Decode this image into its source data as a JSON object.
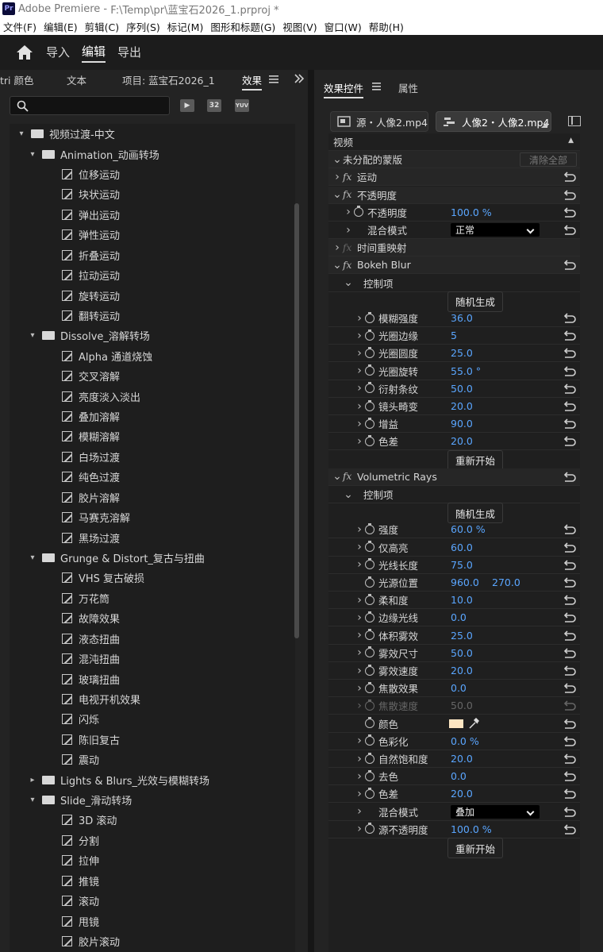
{
  "window": {
    "app": "Adobe Premiere",
    "path": "F:\\Temp\\pr\\蓝宝石2026_1.prproj *",
    "logo": "Pr"
  },
  "menu": [
    "文件(F)",
    "编辑(E)",
    "剪辑(C)",
    "序列(S)",
    "标记(M)",
    "图形和标题(G)",
    "视图(V)",
    "窗口(W)",
    "帮助(H)"
  ],
  "workspace": {
    "tabs": [
      "导入",
      "编辑",
      "导出"
    ],
    "active": "编辑"
  },
  "left_panel": {
    "tabs": [
      "tri 颜色",
      "文本",
      "项目: 蓝宝石2026_1",
      "效果"
    ],
    "active_tab": "效果",
    "search_placeholder": "",
    "filter_icons": [
      "32",
      "YUV"
    ],
    "tree": [
      {
        "label": "视频过渡-中文",
        "level": 0,
        "type": "folder",
        "expanded": true
      },
      {
        "label": "Animation_动画转场",
        "level": 1,
        "type": "folder",
        "expanded": true
      },
      {
        "label": "位移运动",
        "level": 2,
        "type": "preset"
      },
      {
        "label": "块状运动",
        "level": 2,
        "type": "preset"
      },
      {
        "label": "弹出运动",
        "level": 2,
        "type": "preset"
      },
      {
        "label": "弹性运动",
        "level": 2,
        "type": "preset"
      },
      {
        "label": "折叠运动",
        "level": 2,
        "type": "preset"
      },
      {
        "label": "拉动运动",
        "level": 2,
        "type": "preset"
      },
      {
        "label": "旋转运动",
        "level": 2,
        "type": "preset"
      },
      {
        "label": "翻转运动",
        "level": 2,
        "type": "preset"
      },
      {
        "label": "Dissolve_溶解转场",
        "level": 1,
        "type": "folder",
        "expanded": true
      },
      {
        "label": "Alpha 通道烧蚀",
        "level": 2,
        "type": "preset"
      },
      {
        "label": "交叉溶解",
        "level": 2,
        "type": "preset"
      },
      {
        "label": "亮度淡入淡出",
        "level": 2,
        "type": "preset"
      },
      {
        "label": "叠加溶解",
        "level": 2,
        "type": "preset"
      },
      {
        "label": "模糊溶解",
        "level": 2,
        "type": "preset"
      },
      {
        "label": "白场过渡",
        "level": 2,
        "type": "preset"
      },
      {
        "label": "纯色过渡",
        "level": 2,
        "type": "preset"
      },
      {
        "label": "胶片溶解",
        "level": 2,
        "type": "preset"
      },
      {
        "label": "马赛克溶解",
        "level": 2,
        "type": "preset"
      },
      {
        "label": "黑场过渡",
        "level": 2,
        "type": "preset"
      },
      {
        "label": "Grunge & Distort_复古与扭曲",
        "level": 1,
        "type": "folder",
        "expanded": true
      },
      {
        "label": "VHS 复古破损",
        "level": 2,
        "type": "preset"
      },
      {
        "label": "万花筒",
        "level": 2,
        "type": "preset"
      },
      {
        "label": "故障效果",
        "level": 2,
        "type": "preset"
      },
      {
        "label": "液态扭曲",
        "level": 2,
        "type": "preset"
      },
      {
        "label": "混沌扭曲",
        "level": 2,
        "type": "preset"
      },
      {
        "label": "玻璃扭曲",
        "level": 2,
        "type": "preset"
      },
      {
        "label": "电视开机效果",
        "level": 2,
        "type": "preset"
      },
      {
        "label": "闪烁",
        "level": 2,
        "type": "preset"
      },
      {
        "label": "陈旧复古",
        "level": 2,
        "type": "preset"
      },
      {
        "label": "震动",
        "level": 2,
        "type": "preset"
      },
      {
        "label": "Lights & Blurs_光效与模糊转场",
        "level": 1,
        "type": "folder",
        "expanded": false
      },
      {
        "label": "Slide_滑动转场",
        "level": 1,
        "type": "folder",
        "expanded": true
      },
      {
        "label": "3D 滚动",
        "level": 2,
        "type": "preset"
      },
      {
        "label": "分割",
        "level": 2,
        "type": "preset"
      },
      {
        "label": "拉伸",
        "level": 2,
        "type": "preset"
      },
      {
        "label": "推镜",
        "level": 2,
        "type": "preset"
      },
      {
        "label": "滚动",
        "level": 2,
        "type": "preset"
      },
      {
        "label": "甩镜",
        "level": 2,
        "type": "preset"
      },
      {
        "label": "胶片滚动",
        "level": 2,
        "type": "preset"
      }
    ]
  },
  "right_panel": {
    "tabs": [
      "效果控件",
      "属性"
    ],
    "active_tab": "效果控件",
    "source_label": "源・人像2.mp4",
    "sequence_label": "人像2・人像2.mp4",
    "rows": [
      {
        "kind": "section",
        "label": "视频"
      },
      {
        "kind": "mask",
        "label": "未分配的蒙版",
        "button": "清除全部"
      },
      {
        "kind": "effect",
        "label": "运动",
        "fx": true,
        "reset": true
      },
      {
        "kind": "effect",
        "label": "不透明度",
        "fx": true,
        "expanded": true,
        "reset": true
      },
      {
        "kind": "param",
        "indent": 1,
        "stopwatch": true,
        "label": "不透明度",
        "value": "100.0 %",
        "reset": true
      },
      {
        "kind": "dropdown",
        "indent": 1,
        "label": "混合模式",
        "value": "正常",
        "reset": true
      },
      {
        "kind": "effect",
        "label": "时间重映射",
        "fx": true,
        "fxdim": true
      },
      {
        "kind": "effect",
        "label": "Bokeh Blur",
        "fx": true,
        "expanded": true,
        "reset": true
      },
      {
        "kind": "group",
        "label": "控制项"
      },
      {
        "kind": "button",
        "label": "随机生成"
      },
      {
        "kind": "param",
        "indent": 2,
        "stopwatch": true,
        "label": "模糊强度",
        "value": "36.0",
        "reset": true
      },
      {
        "kind": "param",
        "indent": 2,
        "stopwatch": true,
        "label": "光圈边缘",
        "value": "5",
        "reset": true
      },
      {
        "kind": "param",
        "indent": 2,
        "stopwatch": true,
        "label": "光圈圆度",
        "value": "25.0",
        "reset": true
      },
      {
        "kind": "param",
        "indent": 2,
        "stopwatch": true,
        "label": "光圈旋转",
        "value": "55.0 °",
        "reset": true
      },
      {
        "kind": "param",
        "indent": 2,
        "stopwatch": true,
        "label": "衍射条纹",
        "value": "50.0",
        "reset": true
      },
      {
        "kind": "param",
        "indent": 2,
        "stopwatch": true,
        "label": "镜头畸变",
        "value": "20.0",
        "reset": true
      },
      {
        "kind": "param",
        "indent": 2,
        "stopwatch": true,
        "label": "增益",
        "value": "90.0",
        "reset": true
      },
      {
        "kind": "param",
        "indent": 2,
        "stopwatch": true,
        "label": "色差",
        "value": "20.0",
        "reset": true
      },
      {
        "kind": "button",
        "label": "重新开始"
      },
      {
        "kind": "effect",
        "label": "Volumetric Rays",
        "fx": true,
        "expanded": true,
        "reset": true
      },
      {
        "kind": "group",
        "label": "控制项"
      },
      {
        "kind": "button",
        "label": "随机生成"
      },
      {
        "kind": "param",
        "indent": 2,
        "stopwatch": true,
        "label": "强度",
        "value": "60.0 %",
        "reset": true
      },
      {
        "kind": "param",
        "indent": 2,
        "stopwatch": true,
        "label": "仅高亮",
        "value": "60.0",
        "reset": true
      },
      {
        "kind": "param",
        "indent": 2,
        "stopwatch": true,
        "label": "光线长度",
        "value": "75.0",
        "reset": true
      },
      {
        "kind": "param",
        "indent": 2,
        "stopwatch": true,
        "chev": false,
        "label": "光源位置",
        "value": "960.0",
        "value2": "270.0",
        "reset": true
      },
      {
        "kind": "param",
        "indent": 2,
        "stopwatch": true,
        "label": "柔和度",
        "value": "10.0",
        "reset": true
      },
      {
        "kind": "param",
        "indent": 2,
        "stopwatch": true,
        "label": "边缘光线",
        "value": "0.0",
        "reset": true
      },
      {
        "kind": "param",
        "indent": 2,
        "stopwatch": true,
        "label": "体积雾效",
        "value": "25.0",
        "reset": true
      },
      {
        "kind": "param",
        "indent": 2,
        "stopwatch": true,
        "label": "雾效尺寸",
        "value": "50.0",
        "reset": true
      },
      {
        "kind": "param",
        "indent": 2,
        "stopwatch": true,
        "label": "雾效速度",
        "value": "20.0",
        "reset": true
      },
      {
        "kind": "param",
        "indent": 2,
        "stopwatch": true,
        "label": "焦散效果",
        "value": "0.0",
        "reset": true
      },
      {
        "kind": "param",
        "indent": 2,
        "stopwatch": true,
        "label": "焦散速度",
        "value": "50.0",
        "reset": true,
        "disabled": true
      },
      {
        "kind": "color",
        "indent": 2,
        "stopwatch": true,
        "chev": false,
        "label": "颜色",
        "color": "#fde6c2",
        "reset": true
      },
      {
        "kind": "param",
        "indent": 2,
        "stopwatch": true,
        "label": "色彩化",
        "value": "0.0 %",
        "reset": true
      },
      {
        "kind": "param",
        "indent": 2,
        "stopwatch": true,
        "label": "自然饱和度",
        "value": "20.0",
        "reset": true
      },
      {
        "kind": "param",
        "indent": 2,
        "stopwatch": true,
        "label": "去色",
        "value": "0.0",
        "reset": true
      },
      {
        "kind": "param",
        "indent": 2,
        "stopwatch": true,
        "label": "色差",
        "value": "20.0",
        "reset": true
      },
      {
        "kind": "dropdown",
        "indent": 2,
        "label": "混合模式",
        "value": "叠加",
        "reset": true
      },
      {
        "kind": "param",
        "indent": 2,
        "stopwatch": true,
        "label": "源不透明度",
        "value": "100.0 %",
        "reset": true
      },
      {
        "kind": "button",
        "label": "重新开始"
      }
    ]
  },
  "colors": {
    "accent_value": "#5aa6ff",
    "panel_bg": "#232323",
    "tree_bg": "#1e1e1e"
  }
}
